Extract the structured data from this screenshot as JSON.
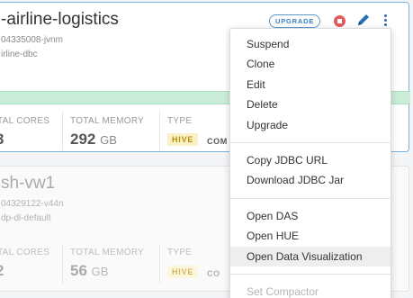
{
  "card1": {
    "title": "-airline-logistics",
    "subtitle1": "04335008-jvnm",
    "subtitle2": "irline-dbc",
    "upgrade_badge": "UPGRADE",
    "stats": {
      "cores_label": "TAL CORES",
      "cores_value": "3",
      "memory_label": "TOTAL MEMORY",
      "memory_value": "292",
      "memory_unit": "GB",
      "type_label": "TYPE",
      "type_badge": "HIVE",
      "compactor_text": "COM"
    }
  },
  "card2": {
    "title": "sh-vw1",
    "subtitle1": "04329122-v44n",
    "subtitle2": "dp-dl-default",
    "stats": {
      "cores_label": "TAL CORES",
      "cores_value": "2",
      "memory_label": "TOTAL MEMORY",
      "memory_value": "56",
      "memory_unit": "GB",
      "type_label": "TYPE",
      "type_badge": "HIVE",
      "compactor_text": "CO"
    }
  },
  "menu": {
    "group1": [
      "Suspend",
      "Clone",
      "Edit",
      "Delete",
      "Upgrade"
    ],
    "group2": [
      "Copy JDBC URL",
      "Download JDBC Jar"
    ],
    "group3": [
      "Open DAS",
      "Open HUE",
      "Open Data Visualization"
    ],
    "group4": [
      "Set Compactor"
    ]
  },
  "colors": {
    "accent": "#2e6fb4",
    "stop": "#e45b5b",
    "progress": "#c9edd9",
    "hive_badge_bg": "#fbf1c7"
  }
}
